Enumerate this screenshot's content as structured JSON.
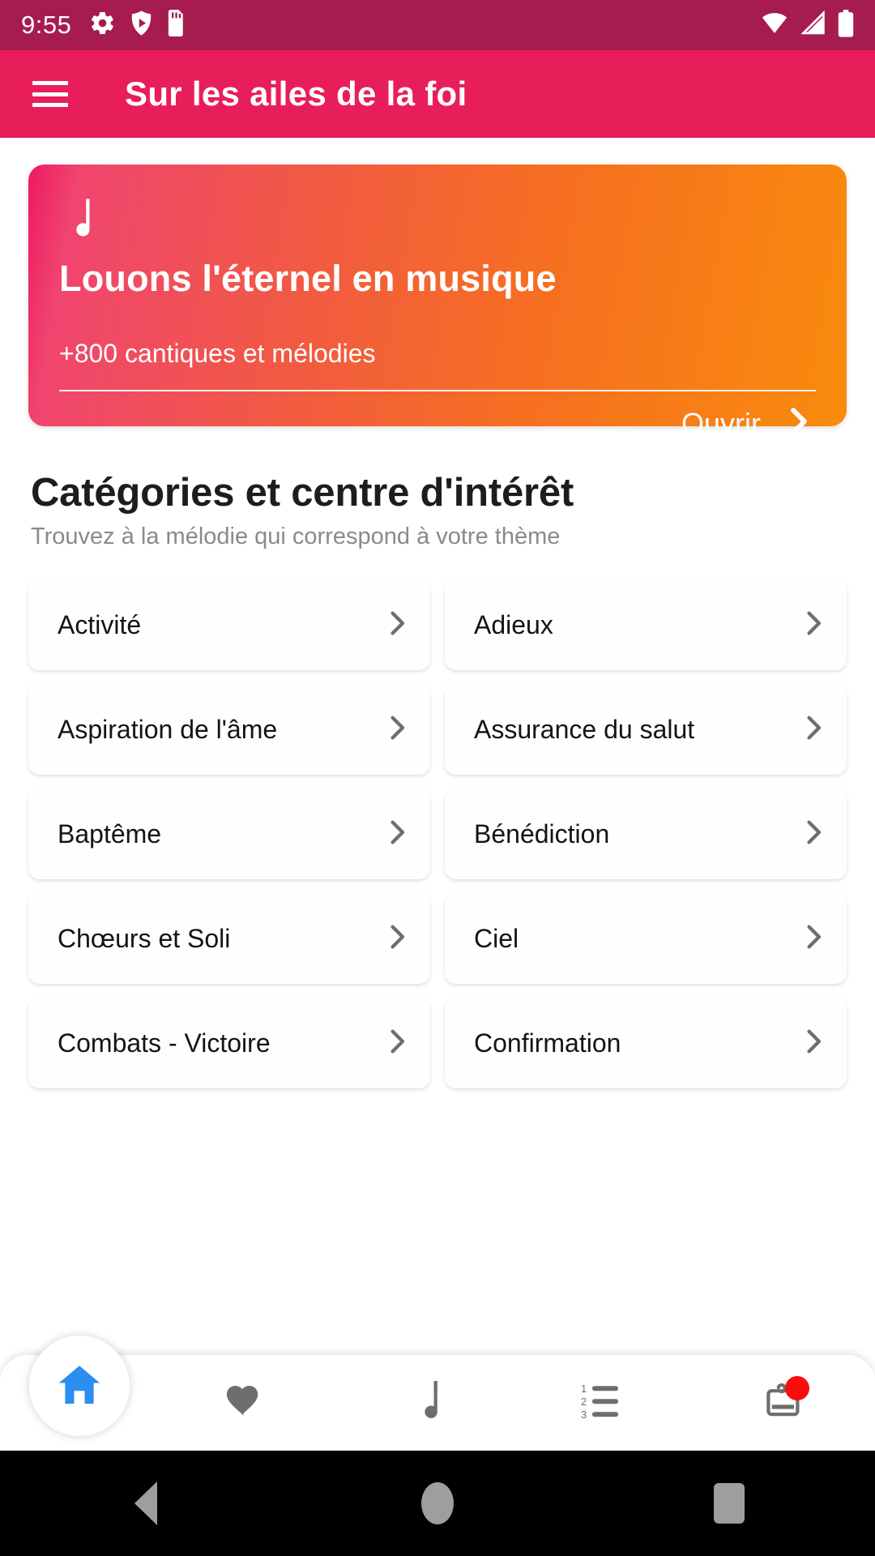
{
  "statusbar": {
    "time": "9:55",
    "icons_left": [
      "gear-icon",
      "shield-play-icon",
      "sd-card-icon"
    ],
    "icons_right": [
      "wifi-icon",
      "signal-icon",
      "battery-icon"
    ]
  },
  "appbar": {
    "menu_icon": "hamburger-menu-icon",
    "title": "Sur les ailes de la foi",
    "background": "#e81e5a"
  },
  "hero": {
    "note_icon": "music-note-icon",
    "title": "Louons l'éternel en musique",
    "subtitle": "+800 cantiques et mélodies",
    "action_label": "Ouvrir",
    "action_icon": "chevron-right-icon",
    "gradient_start": "#ed1a63",
    "gradient_end": "#f98b0c"
  },
  "section": {
    "title": "Catégories et centre d'intérêt",
    "subtitle": "Trouvez à la mélodie qui correspond à votre thème"
  },
  "categories": [
    {
      "label": "Activité"
    },
    {
      "label": "Adieux"
    },
    {
      "label": "Aspiration de l'âme"
    },
    {
      "label": "Assurance du salut"
    },
    {
      "label": "Baptême"
    },
    {
      "label": "Bénédiction"
    },
    {
      "label": "Chœurs et Soli"
    },
    {
      "label": "Ciel"
    },
    {
      "label": "Combats - Victoire"
    },
    {
      "label": "Confirmation"
    }
  ],
  "bottomnav": {
    "active_color": "#2b8ef0",
    "inactive_color": "#6e6e6e",
    "badge_color": "#fb0d0d",
    "items": [
      {
        "name": "home",
        "icon": "home-icon",
        "active": true
      },
      {
        "name": "favorites",
        "icon": "heart-icon",
        "active": false
      },
      {
        "name": "music",
        "icon": "music-note-icon",
        "active": false
      },
      {
        "name": "playlist",
        "icon": "numbered-list-icon",
        "active": false
      },
      {
        "name": "news",
        "icon": "news-icon",
        "active": false,
        "badge": true
      }
    ]
  },
  "androidnav": {
    "back": "back-icon",
    "home": "home-circle-icon",
    "recents": "recents-icon"
  }
}
